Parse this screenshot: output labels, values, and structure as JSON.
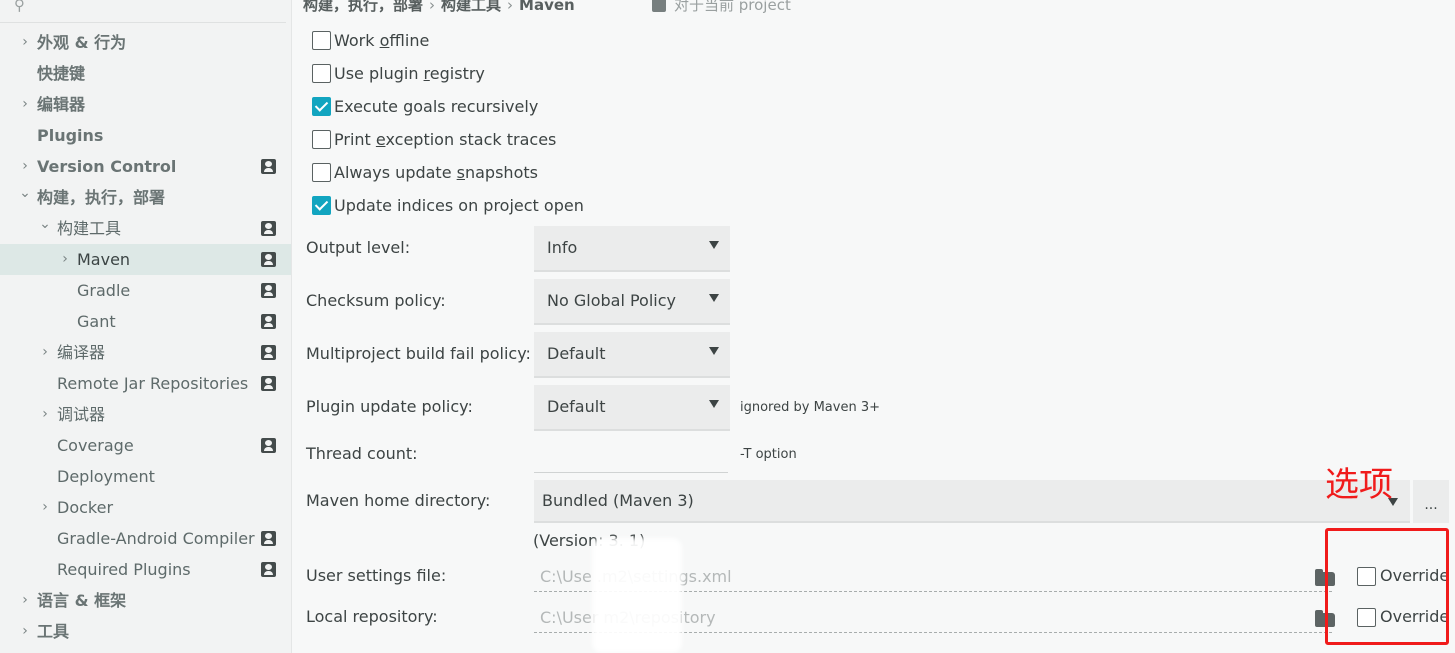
{
  "sidebar": {
    "items": [
      {
        "label": "外观 & 行为",
        "chevron": "›"
      },
      {
        "label": "快捷键",
        "chevron": ""
      },
      {
        "label": "编辑器",
        "chevron": "›"
      },
      {
        "label": "Plugins",
        "chevron": ""
      },
      {
        "label": "Version Control",
        "chevron": "›"
      },
      {
        "label": "构建，执行，部署",
        "chevron": "⌄"
      },
      {
        "label": "构建工具",
        "chevron": "⌄"
      },
      {
        "label": "Maven",
        "chevron": "›"
      },
      {
        "label": "Gradle",
        "chevron": ""
      },
      {
        "label": "Gant",
        "chevron": ""
      },
      {
        "label": "编译器",
        "chevron": "›"
      },
      {
        "label": "Remote Jar Repositories",
        "chevron": ""
      },
      {
        "label": "调试器",
        "chevron": "›"
      },
      {
        "label": "Coverage",
        "chevron": ""
      },
      {
        "label": "Deployment",
        "chevron": ""
      },
      {
        "label": "Docker",
        "chevron": "›"
      },
      {
        "label": "Gradle-Android Compiler",
        "chevron": ""
      },
      {
        "label": "Required Plugins",
        "chevron": ""
      },
      {
        "label": "语言 & 框架",
        "chevron": "›"
      },
      {
        "label": "工具",
        "chevron": "›"
      }
    ]
  },
  "breadcrumb": {
    "part1": "构建，执行，部署",
    "sep": "›",
    "part2": "构建工具",
    "part3": "Maven",
    "project_note": "对于当前 project"
  },
  "options": {
    "work_offline": {
      "pre": "Work ",
      "mnemonic": "o",
      "post": "ffline",
      "checked": false
    },
    "use_plugin_registry": {
      "pre": "Use plugin ",
      "mnemonic": "r",
      "post": "egistry",
      "checked": false
    },
    "execute_goals": {
      "pre": "Execute goals recursively",
      "mnemonic": "",
      "post": "",
      "checked": true
    },
    "print_exception": {
      "pre": "Print ",
      "mnemonic": "e",
      "post": "xception stack traces",
      "checked": false
    },
    "always_update": {
      "pre": "Always update ",
      "mnemonic": "s",
      "post": "napshots",
      "checked": false
    },
    "update_indices": {
      "pre": "Update indices on project open",
      "mnemonic": "",
      "post": "",
      "checked": true
    }
  },
  "form": {
    "output_level_label": "Output level:",
    "output_level_value": "Info",
    "checksum_label": "Checksum policy:",
    "checksum_value": "No Global Policy",
    "multiproject_label": "Multiproject build fail policy:",
    "multiproject_value": "Default",
    "plugin_update_label": "Plugin update policy:",
    "plugin_update_value": "Default",
    "plugin_update_hint": "ignored by Maven 3+",
    "thread_count_label": "Thread count:",
    "thread_count_hint": "-T option",
    "maven_home_label": "Maven home directory:",
    "maven_home_value": "Bundled (Maven 3)",
    "browse_label": "...",
    "version_text": "(Version: 3.  1)",
    "user_settings_label": "User settings file:",
    "user_settings_value": "C:\\Use                .m2\\settings.xml",
    "local_repo_label": "Local repository:",
    "local_repo_value": "C:\\User                m2\\repository",
    "override_label": "Override"
  },
  "annotation": {
    "text": "选项",
    "color": "#f01b1b"
  },
  "colors": {
    "accent": "#12a5c0",
    "selected_row": "#dde8e6"
  }
}
